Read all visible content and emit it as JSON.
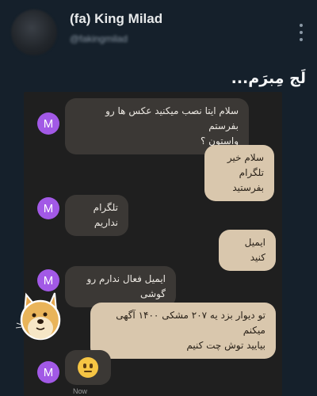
{
  "profile": {
    "display_name": "(fa) King Milad",
    "handle": "@fakingmilad"
  },
  "tweet": {
    "text": "لَج مِبرَم..."
  },
  "chat": {
    "avatar_letter": "M",
    "messages": [
      {
        "side": "in",
        "text_lines": [
          "سلام ایتا نصب میکنید عکس ها رو بفرستم",
          "واستون ؟"
        ]
      },
      {
        "side": "out",
        "text_lines": [
          "سلام خیر",
          "تلگرام بفرستید"
        ]
      },
      {
        "side": "in",
        "text_lines": [
          "تلگرام نداریم"
        ]
      },
      {
        "side": "out",
        "text_lines": [
          "ایمیل کنید"
        ]
      },
      {
        "side": "in",
        "text_lines": [
          "ایمیل فعال ندارم رو گوشی"
        ]
      },
      {
        "side": "out",
        "text_lines": [
          "تو دیوار بزد یه ۲۰۷ مشکی ۱۴۰۰ آگهی میکنم",
          "بیایید توش چت کنیم"
        ]
      },
      {
        "side": "in",
        "emoji": "neutral-face"
      }
    ],
    "timestamp": "Now"
  },
  "colors": {
    "background": "#15202b",
    "chat_background": "#1f1f1f",
    "incoming_bubble": "#3b3835",
    "outgoing_bubble": "#d9c7ad",
    "avatar": "#a259e6"
  }
}
